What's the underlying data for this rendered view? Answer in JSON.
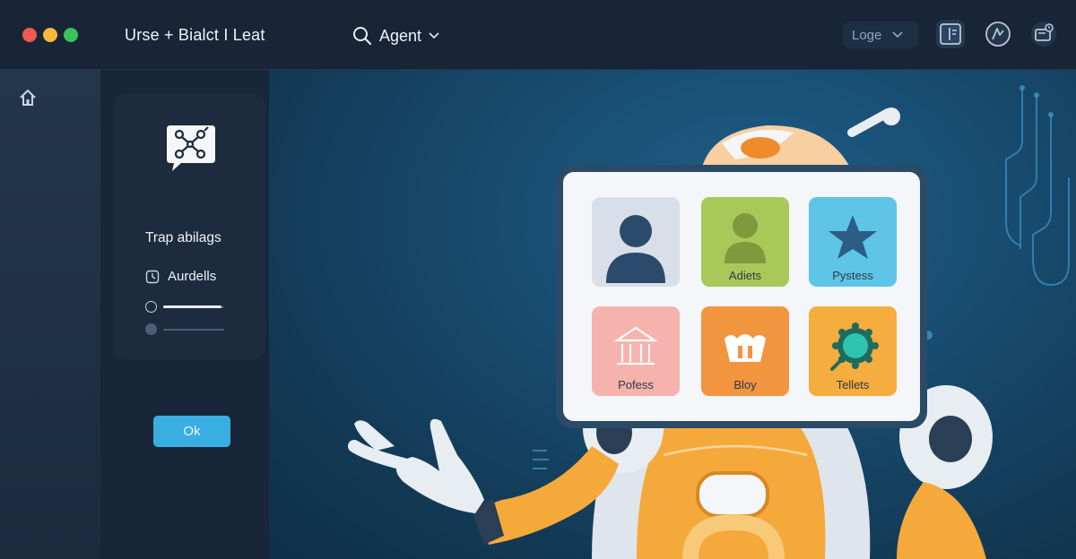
{
  "window": {
    "title": "Urse + Bialct I Leat",
    "traffic_lights": [
      "#f05a52",
      "#f4b83a",
      "#3fc25c"
    ]
  },
  "header": {
    "agent_label": "Agent",
    "logo_select_label": "Loge",
    "icons": [
      "search-icon",
      "chevron-down-icon",
      "panel-icon",
      "compass-icon",
      "device-icon"
    ]
  },
  "sidebar": {
    "home_icon": "home-icon"
  },
  "panel": {
    "heading": "Trap abilags",
    "row_label": "Aurdells",
    "slider_1_value": 0.95,
    "slider_2_value": 0,
    "ok_label": "Ok"
  },
  "grid": {
    "tiles": [
      {
        "label": "",
        "icon": "person-icon",
        "color": "#d8dfe8"
      },
      {
        "label": "Adiets",
        "icon": "person-icon",
        "color": "#a8c85a"
      },
      {
        "label": "Pystess",
        "icon": "star-icon",
        "color": "#5ec5e6"
      },
      {
        "label": "Pofess",
        "icon": "bank-icon",
        "color": "#f6b3ad"
      },
      {
        "label": "Bloy",
        "icon": "basket-icon",
        "color": "#f2953f"
      },
      {
        "label": "Tellets",
        "icon": "gear-icon",
        "color": "#f4ad3e"
      }
    ]
  },
  "colors": {
    "accent": "#39aee0",
    "robot_orange": "#f5a93a",
    "robot_eye": "#3fe0ee"
  }
}
